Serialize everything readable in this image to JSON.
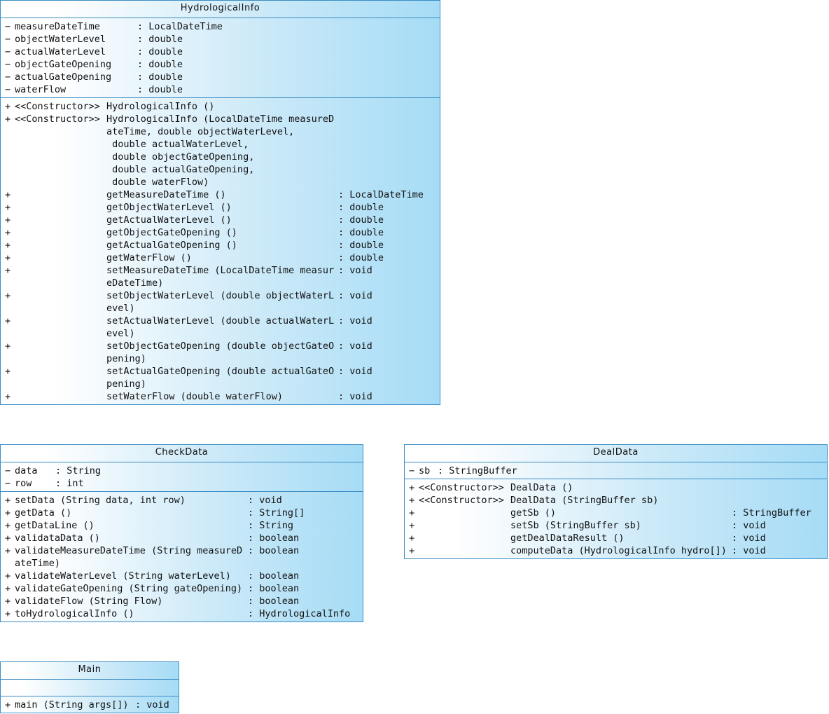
{
  "classes": [
    {
      "title": "HydrologicalInfo",
      "attributes": [
        {
          "vis": "−",
          "name": "measureDateTime",
          "type": ": LocalDateTime"
        },
        {
          "vis": "−",
          "name": "objectWaterLevel",
          "type": ": double"
        },
        {
          "vis": "−",
          "name": "actualWaterLevel",
          "type": ": double"
        },
        {
          "vis": "−",
          "name": "objectGateOpening",
          "type": ": double"
        },
        {
          "vis": "−",
          "name": "actualGateOpening",
          "type": ": double"
        },
        {
          "vis": "−",
          "name": "waterFlow",
          "type": ": double"
        }
      ],
      "operations": [
        {
          "vis": "+",
          "stereo": "<<Constructor>>",
          "name": "HydrologicalInfo ()",
          "type": ""
        },
        {
          "vis": "+",
          "stereo": "<<Constructor>>",
          "name": "HydrologicalInfo (LocalDateTime measureD",
          "cont": [
            "ateTime, double objectWaterLevel,",
            " double actualWaterLevel,",
            " double objectGateOpening,",
            " double actualGateOpening,",
            " double waterFlow)"
          ],
          "type": ""
        },
        {
          "vis": "+",
          "stereo": "",
          "name": "getMeasureDateTime ()",
          "type": ": LocalDateTime"
        },
        {
          "vis": "+",
          "stereo": "",
          "name": "getObjectWaterLevel ()",
          "type": ": double"
        },
        {
          "vis": "+",
          "stereo": "",
          "name": "getActualWaterLevel ()",
          "type": ": double"
        },
        {
          "vis": "+",
          "stereo": "",
          "name": "getObjectGateOpening ()",
          "type": ": double"
        },
        {
          "vis": "+",
          "stereo": "",
          "name": "getActualGateOpening ()",
          "type": ": double"
        },
        {
          "vis": "+",
          "stereo": "",
          "name": "getWaterFlow ()",
          "type": ": double"
        },
        {
          "vis": "+",
          "stereo": "",
          "name": "setMeasureDateTime (LocalDateTime measur",
          "cont": [
            "eDateTime)"
          ],
          "type": ": void"
        },
        {
          "vis": "+",
          "stereo": "",
          "name": "setObjectWaterLevel (double objectWaterL",
          "cont": [
            "evel)"
          ],
          "type": ": void"
        },
        {
          "vis": "+",
          "stereo": "",
          "name": "setActualWaterLevel (double actualWaterL",
          "cont": [
            "evel)"
          ],
          "type": ": void"
        },
        {
          "vis": "+",
          "stereo": "",
          "name": "setObjectGateOpening (double objectGateO",
          "cont": [
            "pening)"
          ],
          "type": ": void"
        },
        {
          "vis": "+",
          "stereo": "",
          "name": "setActualGateOpening (double actualGateO",
          "cont": [
            "pening)"
          ],
          "type": ": void"
        },
        {
          "vis": "+",
          "stereo": "",
          "name": "setWaterFlow (double waterFlow)",
          "type": ": void"
        }
      ]
    },
    {
      "title": "CheckData",
      "attributes": [
        {
          "vis": "−",
          "name": "data",
          "type": ": String"
        },
        {
          "vis": "−",
          "name": "row",
          "type": ": int"
        }
      ],
      "operations": [
        {
          "vis": "+",
          "stereo": "",
          "name": "setData (String data, int row)",
          "type": ": void"
        },
        {
          "vis": "+",
          "stereo": "",
          "name": "getData ()",
          "type": ": String[]"
        },
        {
          "vis": "+",
          "stereo": "",
          "name": "getDataLine ()",
          "type": ": String"
        },
        {
          "vis": "+",
          "stereo": "",
          "name": "validataData ()",
          "type": ": boolean"
        },
        {
          "vis": "+",
          "stereo": "",
          "name": "validateMeasureDateTime (String measureD",
          "cont": [
            "ateTime)"
          ],
          "type": ": boolean"
        },
        {
          "vis": "+",
          "stereo": "",
          "name": "validateWaterLevel (String waterLevel)",
          "type": ": boolean"
        },
        {
          "vis": "+",
          "stereo": "",
          "name": "validateGateOpening (String gateOpening)",
          "type": ": boolean"
        },
        {
          "vis": "+",
          "stereo": "",
          "name": "validateFlow (String Flow)",
          "type": ": boolean"
        },
        {
          "vis": "+",
          "stereo": "",
          "name": "toHydrologicalInfo ()",
          "type": ": HydrologicalInfo"
        }
      ]
    },
    {
      "title": "DealData",
      "attributes": [
        {
          "vis": "−",
          "name": "sb",
          "type": ": StringBuffer"
        }
      ],
      "operations": [
        {
          "vis": "+",
          "stereo": "<<Constructor>>",
          "name": "DealData ()",
          "type": ""
        },
        {
          "vis": "+",
          "stereo": "<<Constructor>>",
          "name": "DealData (StringBuffer sb)",
          "type": ""
        },
        {
          "vis": "+",
          "stereo": "",
          "name": "getSb ()",
          "type": ": StringBuffer"
        },
        {
          "vis": "+",
          "stereo": "",
          "name": "setSb (StringBuffer sb)",
          "type": ": void"
        },
        {
          "vis": "+",
          "stereo": "",
          "name": "getDealDataResult ()",
          "type": ": void"
        },
        {
          "vis": "+",
          "stereo": "",
          "name": "computeData (HydrologicalInfo hydro[])",
          "type": ": void"
        }
      ]
    },
    {
      "title": "Main",
      "attributes": [],
      "operations": [
        {
          "vis": "+",
          "stereo": "",
          "name": "main (String args[])",
          "type": ": void"
        }
      ]
    }
  ]
}
